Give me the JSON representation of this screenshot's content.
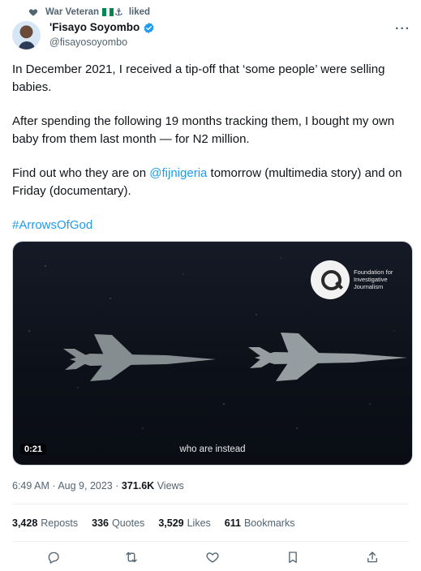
{
  "social_context": {
    "name": "War Veteran",
    "suffix": "liked",
    "flag_colors": [
      "#008751",
      "#ffffff",
      "#008751"
    ],
    "icons": [
      "heart-icon",
      "nigeria-flag-icon",
      "anchor-icon"
    ]
  },
  "author": {
    "display_name": "'Fisayo Soyombo",
    "handle": "@fisayosoyombo",
    "verified": true
  },
  "tweet": {
    "paragraph_1": "In December 2021, I received a tip-off that ‘some people’ were selling babies.",
    "paragraph_2": "After spending the following 19 months tracking them, I bought my own baby from them last month — for N2 million.",
    "paragraph_3_before": "Find out who they are on ",
    "paragraph_3_link": "@fijnigeria",
    "paragraph_3_after": " tomorrow (multimedia story) and on Friday (documentary).",
    "hashtag": "#ArrowsOfGod"
  },
  "media": {
    "timer": "0:21",
    "caption": "who are instead",
    "logo_text_line1": "Foundation for",
    "logo_text_line2": "Investigative",
    "logo_text_line3": "Journalism"
  },
  "meta": {
    "time": "6:49 AM",
    "date": "Aug 9, 2023",
    "views_count": "371.6K",
    "views_label": "Views",
    "separator": "·"
  },
  "stats": {
    "reposts": {
      "count": "3,428",
      "label": "Reposts"
    },
    "quotes": {
      "count": "336",
      "label": "Quotes"
    },
    "likes": {
      "count": "3,529",
      "label": "Likes"
    },
    "bookmarks": {
      "count": "611",
      "label": "Bookmarks"
    }
  },
  "colors": {
    "link": "#1d9bf0",
    "secondary_text": "#536471",
    "primary_text": "#0f1419",
    "verified_badge": "#1d9bf0"
  }
}
